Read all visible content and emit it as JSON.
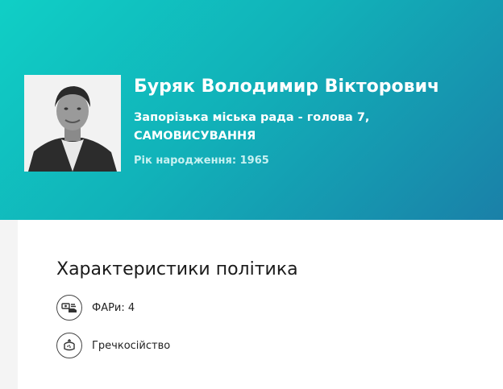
{
  "profile": {
    "name": "Буряк Володимир Вікторович",
    "council_line1": "Запорізька міська рада - голова 7,",
    "council_line2": "САМОВИСУВАННЯ",
    "birth_label": "Рік народження:",
    "birth_year": "1965"
  },
  "characteristics": {
    "title": "Характеристики політика",
    "items": [
      {
        "icon": "cash-hand-icon",
        "label": "ФАРи: 4"
      },
      {
        "icon": "buckwheat-pot-icon",
        "label": "Гречкосійство"
      }
    ]
  },
  "colors": {
    "hero_gradient_start": "#10cfc6",
    "hero_gradient_end": "#1a80a8"
  }
}
